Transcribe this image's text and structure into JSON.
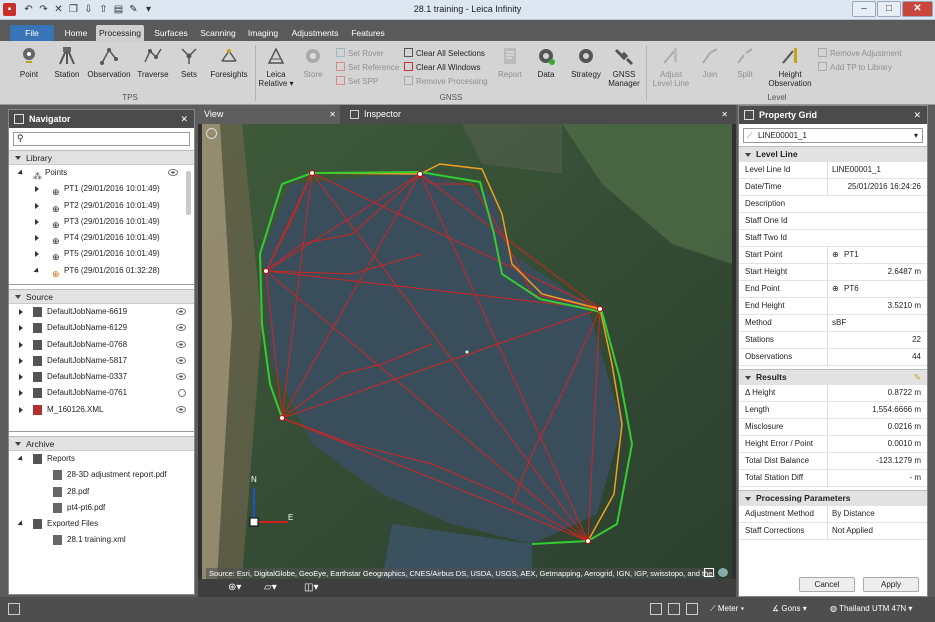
{
  "window": {
    "title": "28.1 training - Leica Infinity"
  },
  "ribbon_tabs": [
    "File",
    "Home",
    "Processing",
    "Surfaces",
    "Scanning",
    "Imaging",
    "Adjustments",
    "Features"
  ],
  "ribbon": {
    "tps": {
      "point": "Point",
      "station": "Station",
      "observation": "Observation",
      "traverse": "Traverse",
      "sets": "Sets",
      "foresights": "Foresights",
      "group": "TPS"
    },
    "gnss": {
      "leica_relative": "Leica Relative ▾",
      "store": "Store",
      "set_rover": "Set Rover",
      "set_reference": "Set Reference",
      "set_spp": "Set SPP",
      "clear_selections": "Clear All Selections",
      "clear_windows": "Clear All Windows",
      "remove_processing": "Remove Processing",
      "report": "Report",
      "data": "Data",
      "strategy": "Strategy",
      "gnss_manager": "GNSS Manager",
      "group": "GNSS"
    },
    "level": {
      "adjust_level_line": "Adjust Level Line",
      "join": "Join",
      "split": "Split",
      "height_observation": "Height Observation",
      "remove_adjustment": "Remove Adjustment",
      "add_tp": "Add TP to Library",
      "group": "Level"
    }
  },
  "navigator": {
    "title": "Navigator",
    "library": {
      "title": "Library",
      "points_label": "Points",
      "points": [
        "PT1 (29/01/2016 10:01:49)",
        "PT2 (29/01/2016 10:01:49)",
        "PT3 (29/01/2016 10:01:49)",
        "PT4 (29/01/2016 10:01:49)",
        "PT5 (29/01/2016 10:01:49)",
        "PT6 (29/01/2016 01:32:28)"
      ]
    },
    "source": {
      "title": "Source",
      "items": [
        "DefaultJobName-6619",
        "DefaultJobName-6129",
        "DefaultJobName-0768",
        "DefaultJobName-5817",
        "DefaultJobName-0337",
        "DefaultJobName-0761",
        "M_160126.XML"
      ]
    },
    "archive": {
      "title": "Archive",
      "reports_label": "Reports",
      "reports": [
        "28-3D adjustment report.pdf",
        "28.pdf",
        "pt4-pt6.pdf"
      ],
      "exported_label": "Exported Files",
      "exported": [
        "28.1 training.xml"
      ]
    }
  },
  "view": {
    "tab_view": "View",
    "tab_inspector": "Inspector",
    "north": "N",
    "east": "E",
    "credit": "Source: Esri, DigitalGlobe, GeoEye, Earthstar Geographics, CNES/Airbus DS, USDA, USGS, AEX, Getmapping, Aerogrid, IGN, IGP, swisstopo, and the"
  },
  "property_grid": {
    "title": "Property Grid",
    "selected": "LINE00001_1",
    "level_line": {
      "title": "Level Line",
      "rows": [
        {
          "k": "Level Line Id",
          "v": "LINE00001_1"
        },
        {
          "k": "Date/Time",
          "v": "25/01/2016 16:24:26"
        },
        {
          "k": "Description",
          "v": ""
        },
        {
          "k": "Staff One Id",
          "v": ""
        },
        {
          "k": "Staff Two Id",
          "v": ""
        },
        {
          "k": "Start Point",
          "v": "PT1"
        },
        {
          "k": "Start Height",
          "v": "2.6487 m"
        },
        {
          "k": "End Point",
          "v": "PT6"
        },
        {
          "k": "End Height",
          "v": "3.5210 m"
        },
        {
          "k": "Method",
          "v": "sBF"
        },
        {
          "k": "Stations",
          "v": "22"
        },
        {
          "k": "Observations",
          "v": "44"
        }
      ]
    },
    "results": {
      "title": "Results",
      "rows": [
        {
          "k": "Δ Height",
          "v": "0.8722 m"
        },
        {
          "k": "Length",
          "v": "1,554.6666 m"
        },
        {
          "k": "Misclosure",
          "v": "0.0216 m"
        },
        {
          "k": "Height Error / Point",
          "v": "0.0010 m"
        },
        {
          "k": "Total Dist Balance",
          "v": "-123.1279 m"
        },
        {
          "k": "Total Station Diff",
          "v": "- m"
        }
      ]
    },
    "processing": {
      "title": "Processing Parameters",
      "rows": [
        {
          "k": "Adjustment Method",
          "v": "By Distance"
        },
        {
          "k": "Staff Corrections",
          "v": "Not Applied"
        }
      ]
    },
    "cancel": "Cancel",
    "apply": "Apply"
  },
  "status": {
    "units": "Meter",
    "angles": "Gons",
    "crs": "Thailand UTM 47N"
  },
  "colors": {
    "accent": "#3a74b8",
    "panel_header": "#4b4b4b",
    "route_red": "#e02020",
    "route_green": "#33cc33",
    "route_orange": "#f0a020"
  }
}
